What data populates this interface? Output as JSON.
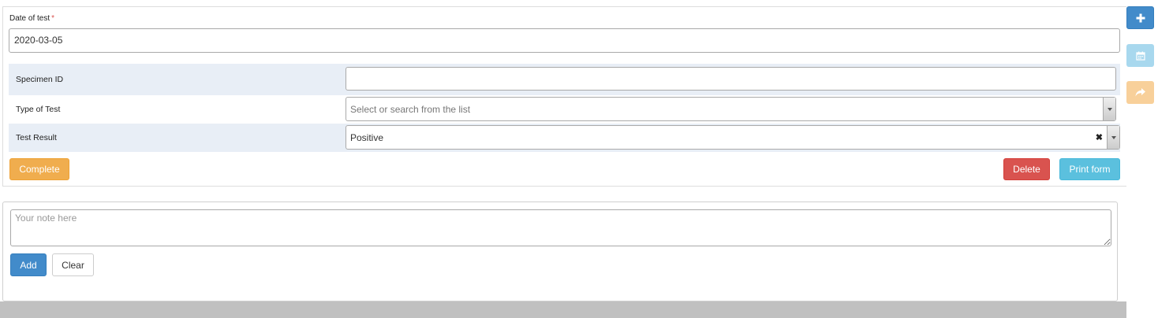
{
  "form": {
    "date_label": "Date of test",
    "required_marker": "*",
    "date_value": "2020-03-05",
    "rows": {
      "specimen_label": "Specimen ID",
      "specimen_value": "",
      "type_label": "Type of Test",
      "type_placeholder": "Select or search from the list",
      "result_label": "Test Result",
      "result_value": "Positive"
    },
    "buttons": {
      "complete": "Complete",
      "delete": "Delete",
      "print": "Print form"
    }
  },
  "side_toolbar": {
    "add_icon": "plus-icon",
    "calendar_icon": "calendar-icon",
    "share_icon": "share-icon"
  },
  "notes": {
    "placeholder": "Your note here",
    "add_label": "Add",
    "clear_label": "Clear"
  },
  "colors": {
    "primary": "#428bca",
    "warning": "#f0ad4e",
    "danger": "#d9534f",
    "info": "#5bc0de",
    "row_shade": "#e8eef6"
  }
}
